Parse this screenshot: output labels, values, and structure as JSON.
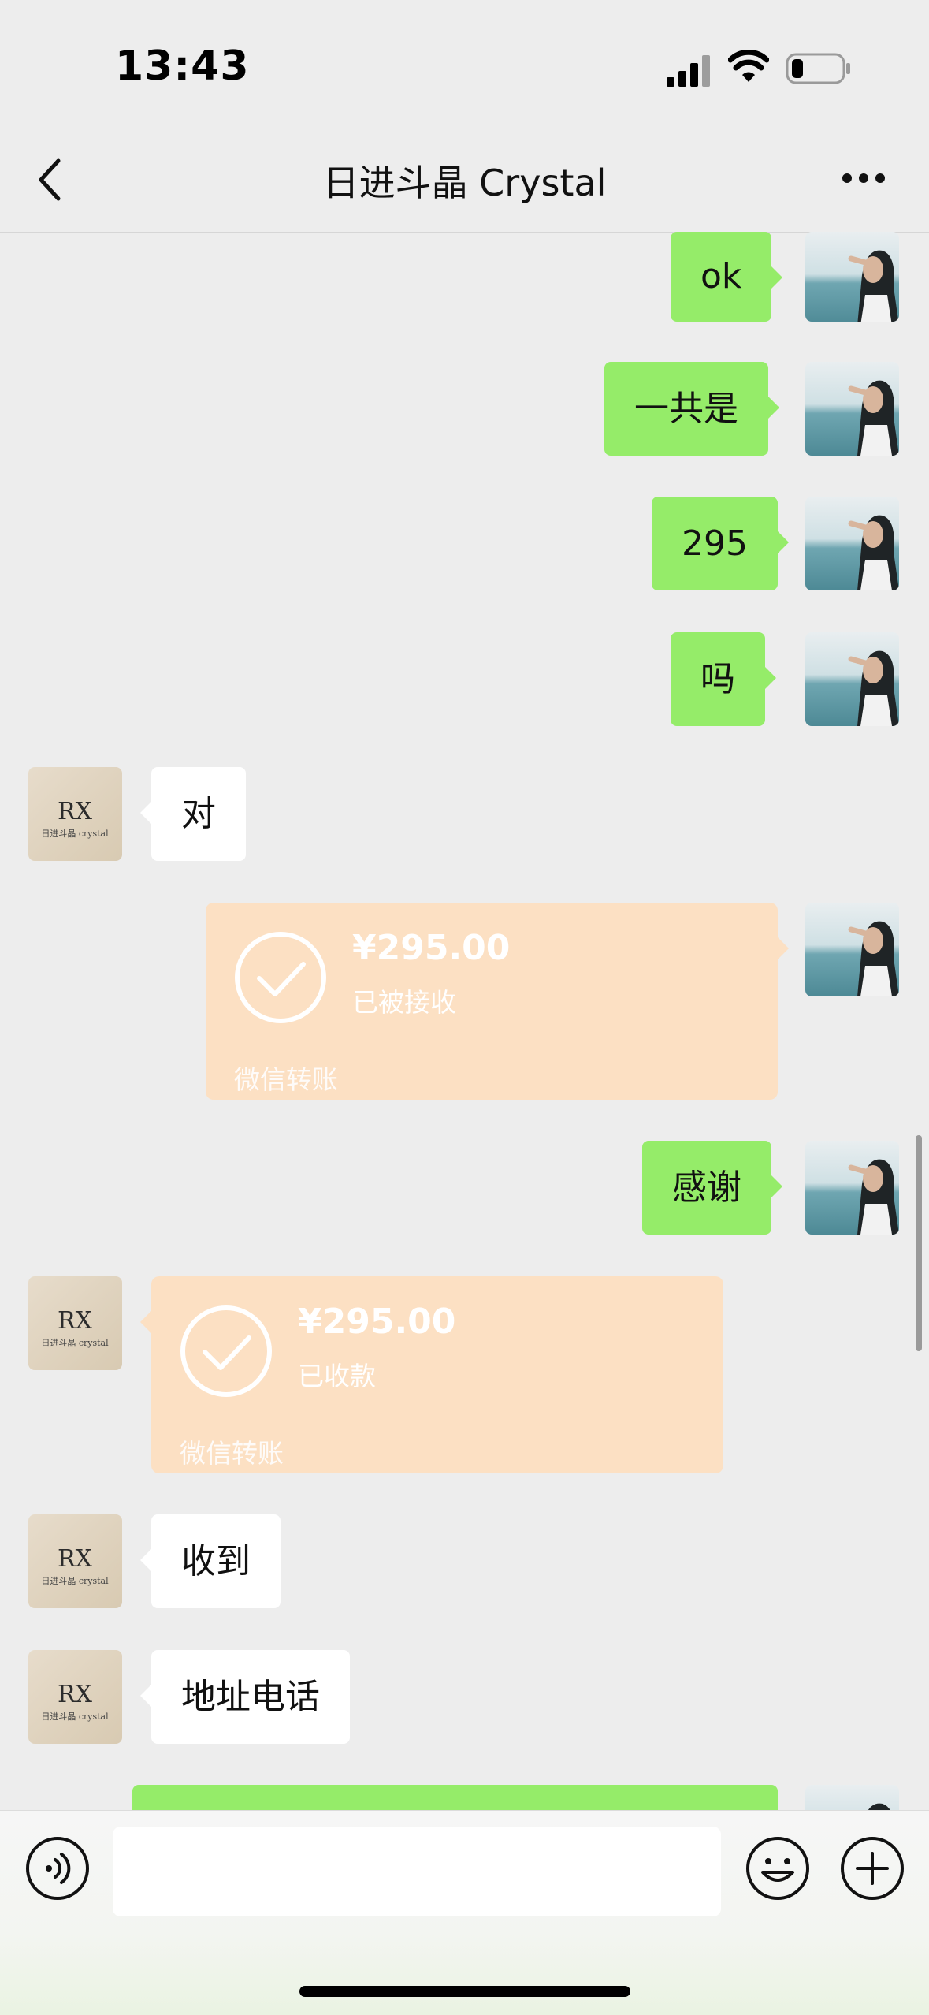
{
  "status_bar": {
    "time": "13:43",
    "icons": [
      "signal-icon",
      "wifi-icon",
      "battery-icon"
    ]
  },
  "header": {
    "title": "日进斗晶 Crystal",
    "back_icon": "chevron-left-icon",
    "more_icon": "more-dots-icon"
  },
  "colors": {
    "my_bubble": "#95ec69",
    "their_bubble": "#ffffff",
    "transfer_card": "#fce0c3",
    "background": "#ededed"
  },
  "messages": [
    {
      "sender": "me",
      "type": "text",
      "text": "ok"
    },
    {
      "sender": "me",
      "type": "text",
      "text": "一共是"
    },
    {
      "sender": "me",
      "type": "text",
      "text": "295"
    },
    {
      "sender": "me",
      "type": "text",
      "text": "吗"
    },
    {
      "sender": "contact",
      "type": "text",
      "text": "对"
    },
    {
      "sender": "me",
      "type": "transfer",
      "amount": "¥295.00",
      "status": "已被接收",
      "label": "微信转账"
    },
    {
      "sender": "me",
      "type": "text",
      "text": "感谢"
    },
    {
      "sender": "contact",
      "type": "transfer",
      "amount": "¥295.00",
      "status": "已收款",
      "label": "微信转账"
    },
    {
      "sender": "contact",
      "type": "text",
      "text": "收到"
    },
    {
      "sender": "contact",
      "type": "text",
      "text": "地址电话"
    }
  ],
  "contact_avatar": {
    "logo_text": "RX",
    "caption": "日进斗晶 crystal"
  },
  "input_bar": {
    "voice_icon": "voice-icon",
    "text_value": "",
    "emoji_icon": "emoji-icon",
    "plus_icon": "plus-icon"
  }
}
